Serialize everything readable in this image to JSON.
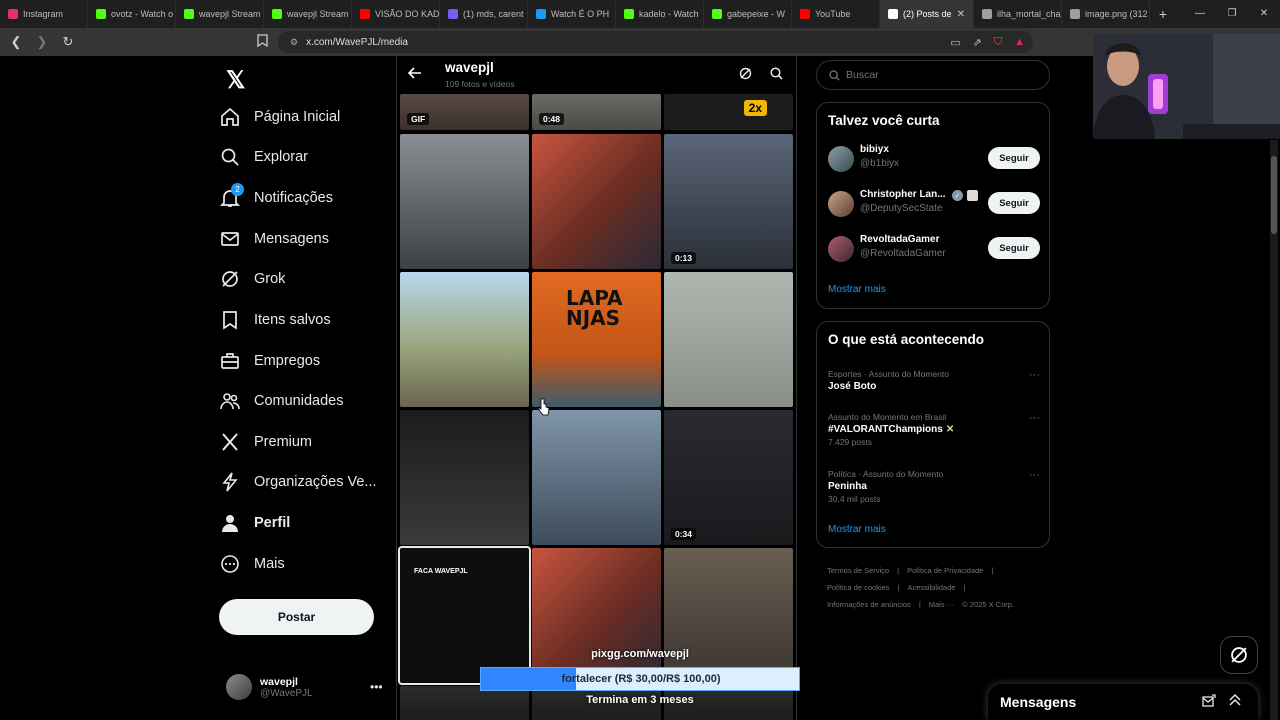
{
  "browser": {
    "tabs": [
      {
        "label": "Instagram",
        "color": "#e1306c"
      },
      {
        "label": "ovotz - Watch o",
        "color": "#53fc18"
      },
      {
        "label": "wavepjl Stream",
        "color": "#53fc18"
      },
      {
        "label": "wavepjl Stream",
        "color": "#53fc18"
      },
      {
        "label": "VISÃO DO KAD",
        "color": "#ff0000"
      },
      {
        "label": "(1) mds, carent",
        "color": "#7a5cf0"
      },
      {
        "label": "Watch É O PH",
        "color": "#1d9bf0"
      },
      {
        "label": "kadelo - Watch",
        "color": "#53fc18"
      },
      {
        "label": "gabepeixe - W",
        "color": "#53fc18"
      },
      {
        "label": "YouTube",
        "color": "#ff0000"
      },
      {
        "label": "(2) Posts de",
        "color": "#ffffff"
      },
      {
        "label": "ilha_mortal_cha",
        "color": "#9aa0a6"
      },
      {
        "label": "image.png (312",
        "color": "#9aa0a6"
      }
    ],
    "active_tab_index": 10,
    "url": "x.com/WavePJL/media"
  },
  "sidebar": {
    "logo": "𝕏",
    "items": [
      {
        "label": "Página Inicial",
        "icon": "home-icon"
      },
      {
        "label": "Explorar",
        "icon": "search-icon"
      },
      {
        "label": "Notificações",
        "icon": "bell-icon",
        "badge": "2"
      },
      {
        "label": "Mensagens",
        "icon": "envelope-icon"
      },
      {
        "label": "Grok",
        "icon": "grok-icon"
      },
      {
        "label": "Itens salvos",
        "icon": "bookmark-icon"
      },
      {
        "label": "Empregos",
        "icon": "briefcase-icon"
      },
      {
        "label": "Comunidades",
        "icon": "people-icon"
      },
      {
        "label": "Premium",
        "icon": "x-logo-icon"
      },
      {
        "label": "Organizações Ve...",
        "icon": "lightning-icon"
      },
      {
        "label": "Perfil",
        "icon": "person-icon"
      },
      {
        "label": "Mais",
        "icon": "more-circle-icon"
      }
    ],
    "post_button": "Postar",
    "account": {
      "name": "wavepjl",
      "handle": "@WavePJL"
    }
  },
  "feed": {
    "title": "wavepjl",
    "subtitle": "109 fotos e vídeos",
    "tiles": [
      {
        "badge": "GIF"
      },
      {
        "badge": "0:48"
      },
      {
        "badge": "",
        "label": "2x"
      },
      {
        "badge": ""
      },
      {
        "badge": ""
      },
      {
        "badge": "0:13"
      },
      {
        "badge": ""
      },
      {
        "badge": "",
        "label": "LAPA\nNJAS"
      },
      {
        "badge": ""
      },
      {
        "badge": ""
      },
      {
        "badge": ""
      },
      {
        "badge": "0:34"
      },
      {
        "badge": "",
        "label": "FACA WAVEPJL"
      },
      {
        "badge": ""
      },
      {
        "badge": ""
      }
    ]
  },
  "pix": {
    "url": "pixgg.com/wavepjl",
    "goal_text": "fortalecer (R$ 30,00/R$ 100,00)",
    "progress": 0.3,
    "ends": "Termina em 3 meses"
  },
  "right": {
    "search_placeholder": "Buscar",
    "who_to_follow": {
      "title": "Talvez você curta",
      "users": [
        {
          "name": "bibiyx",
          "handle": "@b1biyx",
          "follow": "Seguir"
        },
        {
          "name": "Christopher Lan...",
          "handle": "@DeputySecState",
          "follow": "Seguir"
        },
        {
          "name": "RevoltadaGamer",
          "handle": "@RevoltadaGamer",
          "follow": "Seguir"
        }
      ],
      "show_more": "Mostrar mais"
    },
    "trends": {
      "title": "O que está acontecendo",
      "items": [
        {
          "meta": "Esportes · Assunto do Momento",
          "name": "José Boto",
          "count": ""
        },
        {
          "meta": "Assunto do Momento em Brasil",
          "name": "#VALORANTChampions",
          "count": "7.429 posts"
        },
        {
          "meta": "Política · Assunto do Momento",
          "name": "Peninha",
          "count": "30,4 mil posts"
        }
      ],
      "show_more": "Mostrar mais"
    },
    "footer": [
      "Termos de Serviço",
      "|",
      "Política de Privacidade",
      "|",
      "Política de cookies",
      "|",
      "Acessibilidade",
      "|",
      "Informações de anúncios",
      "|",
      "Mais ···",
      "© 2025 X Corp."
    ]
  },
  "messages_dock": {
    "title": "Mensagens"
  }
}
